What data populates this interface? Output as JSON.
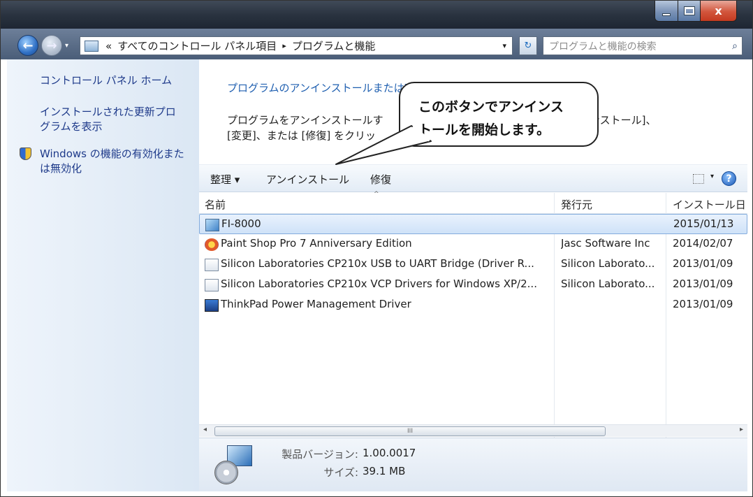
{
  "window": {
    "caption_close": "x"
  },
  "address": {
    "back": "←",
    "forward": "→",
    "overflow": "«",
    "crumb1": "すべてのコントロール パネル項目",
    "crumb_sep": "▸",
    "crumb2": "プログラムと機能",
    "dropdown": "▾",
    "refresh": "↻"
  },
  "search": {
    "placeholder": "プログラムと機能の検索",
    "icon": "magnifier-icon"
  },
  "left_pane": {
    "home": "コントロール パネル ホーム",
    "updates_line1": "インストールされた更新プロ",
    "updates_line2": "グラムを表示",
    "features_line1": "Windows の機能の有効化また",
    "features_line2": "は無効化"
  },
  "content": {
    "title": "プログラムのアンインストールまたは変更",
    "desc_line1_a": "プログラムをアンインストールす",
    "desc_line1_b": "[アンインストール]、",
    "desc_line2": "[変更]、または [修復] をクリッ"
  },
  "toolbar": {
    "organize": "整理 ▾",
    "uninstall": "アンインストール",
    "repair": "修復",
    "view_drop": "▾",
    "help": "?"
  },
  "columns": {
    "name": "名前",
    "publisher": "発行元",
    "installed": "インストール日"
  },
  "programs": [
    {
      "name": "FI-8000",
      "publisher": "",
      "date": "2015/01/13",
      "icon": "fi-icon"
    },
    {
      "name": "Paint Shop Pro 7 Anniversary Edition",
      "publisher": "Jasc Software Inc",
      "date": "2014/02/07",
      "icon": "paint-icon"
    },
    {
      "name": "Silicon Laboratories CP210x USB to UART Bridge (Driver R...",
      "publisher": "Silicon Laborato...",
      "date": "2013/01/09",
      "icon": "silicon-icon"
    },
    {
      "name": "Silicon Laboratories CP210x VCP Drivers for Windows XP/2...",
      "publisher": "Silicon Laborato...",
      "date": "2013/01/09",
      "icon": "silicon-icon"
    },
    {
      "name": "ThinkPad Power Management Driver",
      "publisher": "",
      "date": "2013/01/09",
      "icon": "thinkpad-icon"
    }
  ],
  "scrollbar": {
    "left": "◂",
    "grip": "III",
    "right": "▸"
  },
  "details": {
    "version_label": "製品バージョン:",
    "version_value": "1.00.0017",
    "size_label": "サイズ:",
    "size_value": "39.1 MB"
  },
  "callout": {
    "line1": "このボタンでアンインス",
    "line2": "トールを開始します。"
  }
}
